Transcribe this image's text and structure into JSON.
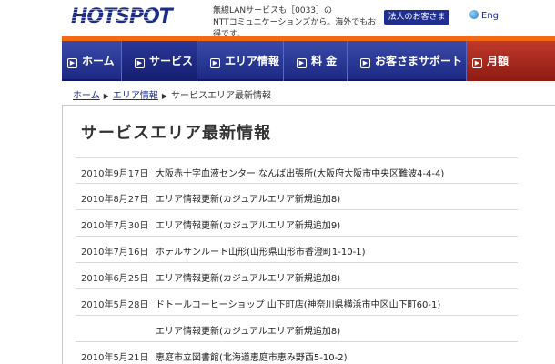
{
  "header": {
    "logo_text": "HOTSPOT",
    "tagline_line1": "無線LANサービスも［0033］の",
    "tagline_line2": "NTTコミュニケーションズから。海外でもお得です。",
    "corporate_button": "法人のお客さま",
    "english_link": "Eng"
  },
  "nav": {
    "items": [
      {
        "label": "ホーム"
      },
      {
        "label": "サービス"
      },
      {
        "label": "エリア情報"
      },
      {
        "label": "料 金"
      },
      {
        "label": "お客さまサポート"
      },
      {
        "label": "月額"
      }
    ]
  },
  "breadcrumb": {
    "home": "ホーム",
    "area": "エリア情報",
    "current": "サービスエリア最新情報"
  },
  "main": {
    "title": "サービスエリア最新情報",
    "news": [
      {
        "date": "2010年9月17日",
        "text": "大阪赤十字血液センター なんば出張所(大阪府大阪市中央区難波4-4-4)"
      },
      {
        "date": "2010年8月27日",
        "text": "エリア情報更新(カジュアルエリア新規追加8)"
      },
      {
        "date": "2010年7月30日",
        "text": "エリア情報更新(カジュアルエリア新規追加9)"
      },
      {
        "date": "2010年7月16日",
        "text": "ホテルサンルート山形(山形県山形市香澄町1-10-1)"
      },
      {
        "date": "2010年6月25日",
        "text": "エリア情報更新(カジュアルエリア新規追加8)"
      },
      {
        "date": "2010年5月28日",
        "text": "ドトールコーヒーショップ 山下町店(神奈川県横浜市中区山下町60-1)"
      },
      {
        "date": "",
        "text": "エリア情報更新(カジュアルエリア新規追加8)"
      },
      {
        "date": "2010年5月21日",
        "text": "恵庭市立図書館(北海道恵庭市恵み野西5-10-2)"
      }
    ]
  },
  "colors": {
    "nav_blue": "#1c2a85",
    "accent_orange": "#f36a12",
    "brand_blue": "#1b2c8a"
  }
}
